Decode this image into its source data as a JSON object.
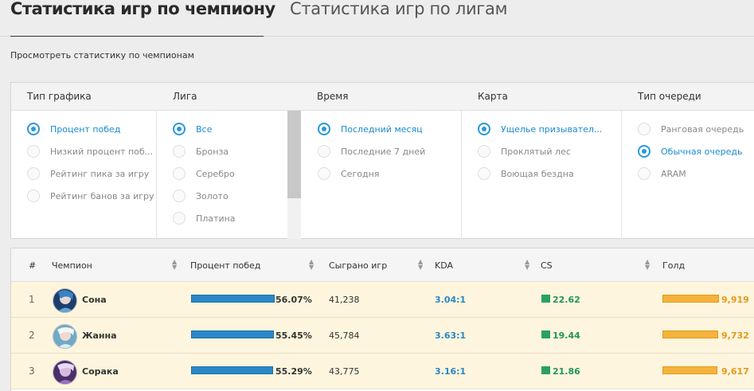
{
  "tabs": [
    {
      "label": "Статистика игр по чемпиону",
      "active": true
    },
    {
      "label": "Статистика игр по лигам",
      "active": false
    }
  ],
  "subtitle": "Просмотреть статистику по чемпионам",
  "filters": {
    "chart_type": {
      "title": "Тип графика",
      "options": [
        "Процент побед",
        "Низкий процент поб...",
        "Рейтинг пика за игру",
        "Рейтинг банов за игру"
      ],
      "selected": 0
    },
    "league": {
      "title": "Лига",
      "options": [
        "Все",
        "Бронза",
        "Серебро",
        "Золото",
        "Платина"
      ],
      "selected": 0
    },
    "time": {
      "title": "Время",
      "options": [
        "Последний месяц",
        "Последние 7 дней",
        "Сегодня"
      ],
      "selected": 0
    },
    "map": {
      "title": "Карта",
      "options": [
        "Ущелье призывател...",
        "Проклятый лес",
        "Воющая бездна"
      ],
      "selected": 0
    },
    "queue": {
      "title": "Тип очереди",
      "options": [
        "Ранговая очередь",
        "Обычная очередь",
        "ARAM"
      ],
      "selected": 1
    }
  },
  "table": {
    "headers": {
      "rank": "#",
      "champion": "Чемпион",
      "winrate": "Процент побед",
      "games": "Сыграно игр",
      "kda": "KDA",
      "cs": "CS",
      "gold": "Голд"
    },
    "rows": [
      {
        "rank": "1",
        "name": "Сона",
        "winrate": "56.07%",
        "winrate_fraction": 0.5607,
        "games": "41,238",
        "kda": "3.04:1",
        "cs": "22.62",
        "gold": "9,919",
        "gold_fraction": 0.9919
      },
      {
        "rank": "2",
        "name": "Жанна",
        "winrate": "55.45%",
        "winrate_fraction": 0.5545,
        "games": "45,784",
        "kda": "3.63:1",
        "cs": "19.44",
        "gold": "9,732",
        "gold_fraction": 0.9732
      },
      {
        "rank": "3",
        "name": "Сорака",
        "winrate": "55.29%",
        "winrate_fraction": 0.5529,
        "games": "43,775",
        "kda": "3.16:1",
        "cs": "21.86",
        "gold": "9,617",
        "gold_fraction": 0.9617
      }
    ]
  },
  "colors": {
    "accent_blue": "#2a98dc",
    "winrate_bar": "#2a88c8",
    "cs_green": "#22955a",
    "gold_orange": "#f4b33d",
    "row_highlight": "#fdf5dd"
  }
}
